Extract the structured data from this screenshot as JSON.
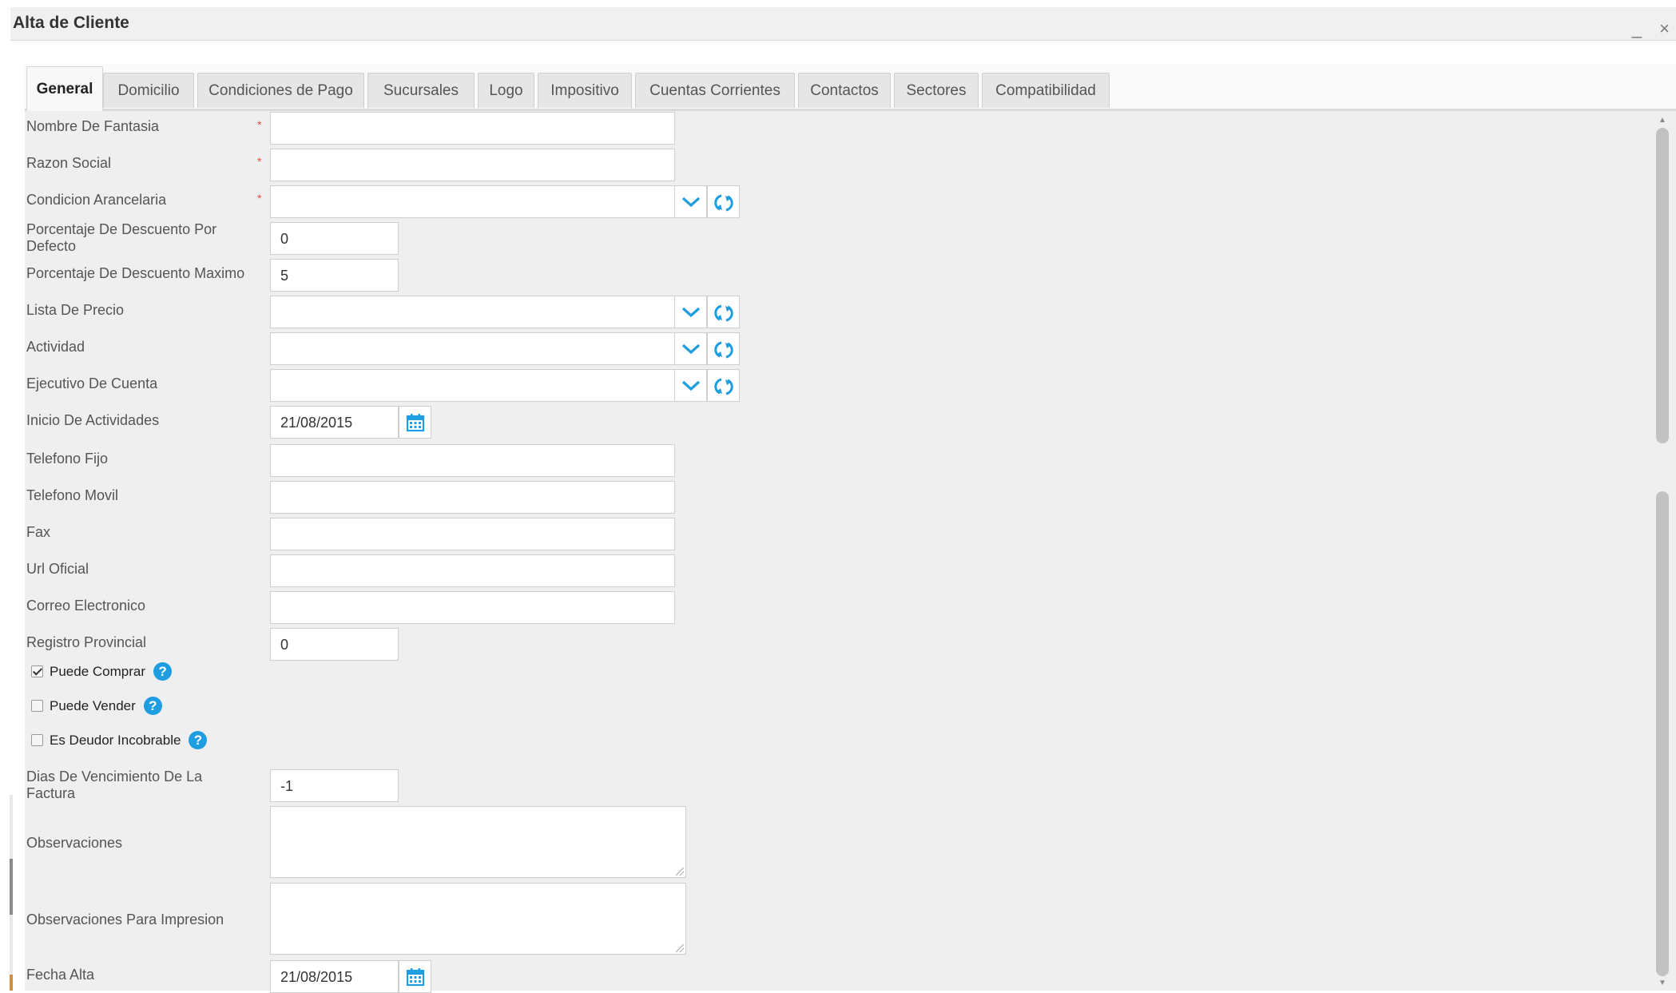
{
  "window": {
    "title": "Alta de Cliente",
    "controls": "_ ×"
  },
  "tabs": [
    {
      "label": "General",
      "active": true
    },
    {
      "label": "Domicilio"
    },
    {
      "label": "Condiciones de Pago"
    },
    {
      "label": "Sucursales"
    },
    {
      "label": "Logo"
    },
    {
      "label": "Impositivo"
    },
    {
      "label": "Cuentas Corrientes"
    },
    {
      "label": "Contactos"
    },
    {
      "label": "Sectores"
    },
    {
      "label": "Compatibilidad"
    }
  ],
  "form": {
    "required_mark": "*",
    "nombre_fantasia": {
      "label": "Nombre De Fantasia",
      "value": ""
    },
    "razon_social": {
      "label": "Razon Social",
      "value": ""
    },
    "condicion_arancelaria": {
      "label": "Condicion Arancelaria",
      "value": ""
    },
    "porc_desc_defecto": {
      "label": "Porcentaje De Descuento Por Defecto",
      "value": "0"
    },
    "porc_desc_maximo": {
      "label": "Porcentaje De Descuento Maximo",
      "value": "5"
    },
    "lista_precio": {
      "label": "Lista De Precio",
      "value": ""
    },
    "actividad": {
      "label": "Actividad",
      "value": ""
    },
    "ejecutivo_cuenta": {
      "label": "Ejecutivo De Cuenta",
      "value": ""
    },
    "inicio_actividades": {
      "label": "Inicio De Actividades",
      "value": "21/08/2015"
    },
    "telefono_fijo": {
      "label": "Telefono Fijo",
      "value": ""
    },
    "telefono_movil": {
      "label": "Telefono Movil",
      "value": ""
    },
    "fax": {
      "label": "Fax",
      "value": ""
    },
    "url_oficial": {
      "label": "Url Oficial",
      "value": ""
    },
    "correo": {
      "label": "Correo Electronico",
      "value": ""
    },
    "registro_provincial": {
      "label": "Registro Provincial",
      "value": "0"
    },
    "puede_comprar": {
      "label": "Puede Comprar",
      "checked": true
    },
    "puede_vender": {
      "label": "Puede Vender",
      "checked": false
    },
    "deudor_incobrable": {
      "label": "Es Deudor Incobrable",
      "checked": false
    },
    "dias_vencimiento": {
      "label": "Dias De Vencimiento De La Factura",
      "value": "-1"
    },
    "observaciones": {
      "label": "Observaciones",
      "value": ""
    },
    "observaciones_impresion": {
      "label": "Observaciones Para Impresion",
      "value": ""
    },
    "fecha_alta": {
      "label": "Fecha Alta",
      "value": "21/08/2015"
    }
  },
  "icons": {
    "dropdown": "chevron-down-icon",
    "refresh": "refresh-icon",
    "calendar": "calendar-icon",
    "help": "help-icon"
  },
  "colors": {
    "accent": "#1e9ee0",
    "required": "#e04b3a",
    "panel_bg": "#efefef"
  }
}
